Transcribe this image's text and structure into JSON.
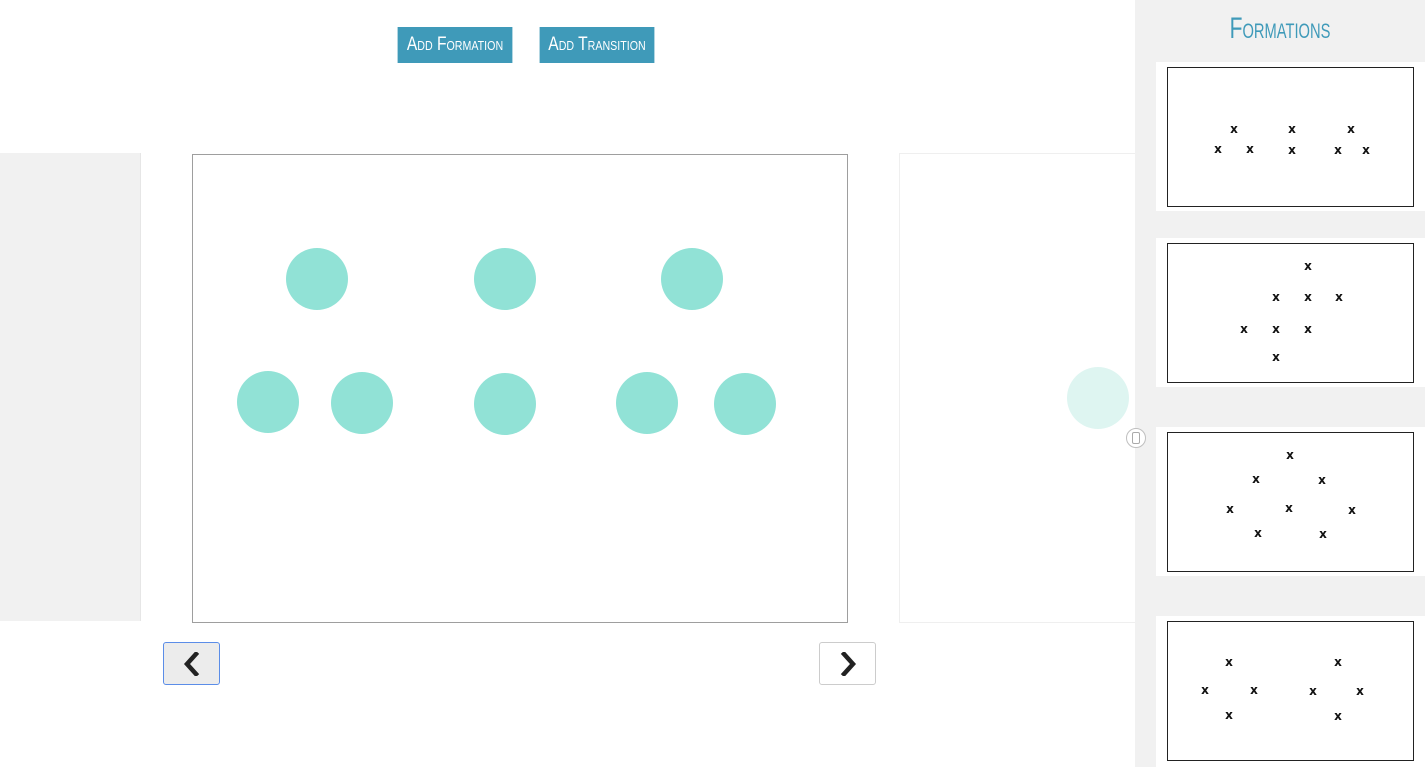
{
  "toolbar": {
    "add_formation_label": "Add Formation",
    "add_transition_label": "Add Transition",
    "accent_color": "#3f9ab9"
  },
  "stage": {
    "dancer_color": "#91e2d6",
    "dancer_count": 8
  },
  "navigation": {
    "prev_icon": "chevron-left-icon",
    "next_icon": "chevron-right-icon"
  },
  "sidebar": {
    "title": "Formations",
    "thumbnails": [
      {
        "name": "formation-1",
        "marker": "x",
        "count": 8
      },
      {
        "name": "formation-2",
        "marker": "x",
        "count": 8
      },
      {
        "name": "formation-3",
        "marker": "x",
        "count": 8
      },
      {
        "name": "formation-4",
        "marker": "x",
        "count": 8
      }
    ]
  }
}
